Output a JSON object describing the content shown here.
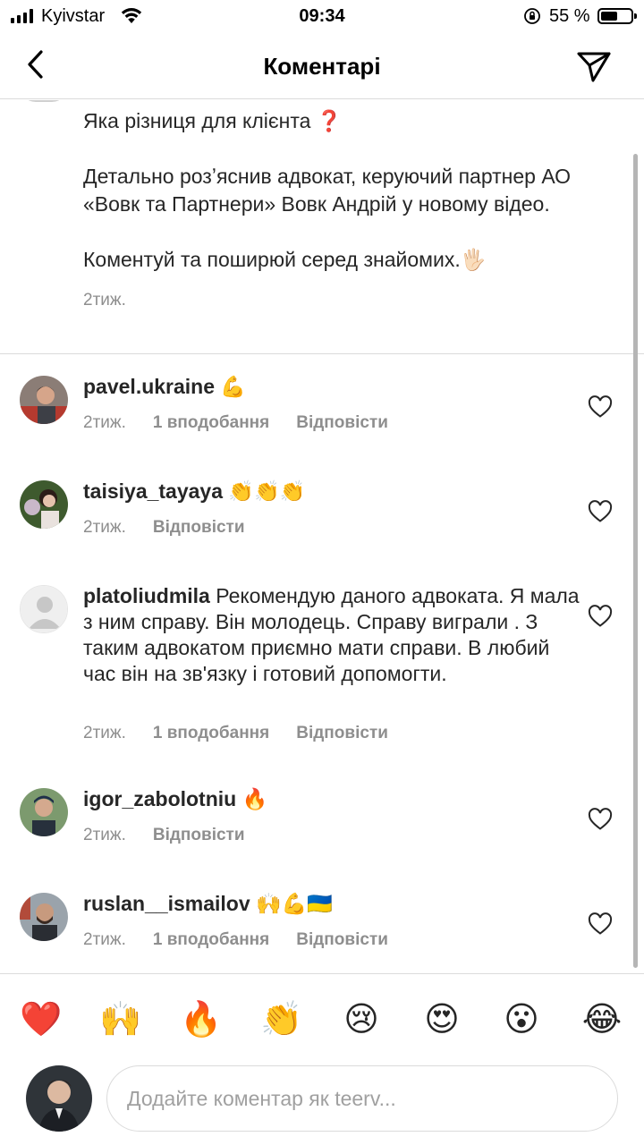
{
  "status_bar": {
    "carrier": "Kyivstar",
    "time": "09:34",
    "battery_percent": "55 %",
    "battery_level": 0.55
  },
  "header": {
    "title": "Коментарі"
  },
  "caption": {
    "text": "Яка різниця для клієнта ❓\n\nДетально розʼяснив адвокат, керуючий партнер АО «Вовк та Партнери» Вовк Андрій у новому відео.\n\nКоментуй та поширюй серед знайомих.🖐🏻",
    "time": "2тиж."
  },
  "comments": [
    {
      "username": "pavel.ukraine",
      "text": "💪",
      "time": "2тиж.",
      "likes": "1 вподобання",
      "reply": "Відповісти"
    },
    {
      "username": "taisiya_tayaya",
      "text": "👏👏👏",
      "time": "2тиж.",
      "likes": "",
      "reply": "Відповісти"
    },
    {
      "username": "platoliudmila",
      "text": "Рекомендую даного адвоката. Я мала з ним справу. Він молодець. Справу виграли . З таким адвокатом приємно мати справи. В любий час він на зв'язку і готовий допомогти.",
      "time": "2тиж.",
      "likes": "1 вподобання",
      "reply": "Відповісти"
    },
    {
      "username": "igor_zabolotniu",
      "text": "🔥",
      "time": "2тиж.",
      "likes": "",
      "reply": "Відповісти"
    },
    {
      "username": "ruslan__ismailov",
      "text": "🙌💪🇺🇦",
      "time": "2тиж.",
      "likes": "1 вподобання",
      "reply": "Відповісти"
    }
  ],
  "reactions": [
    "❤️",
    "🙌",
    "🔥",
    "👏",
    "😢",
    "😍",
    "😮",
    "😂"
  ],
  "composer": {
    "placeholder": "Додайте коментар як teerv..."
  },
  "colors": {
    "text": "#262626",
    "secondary": "#8e8e8e",
    "divider": "#dbdbdb"
  }
}
